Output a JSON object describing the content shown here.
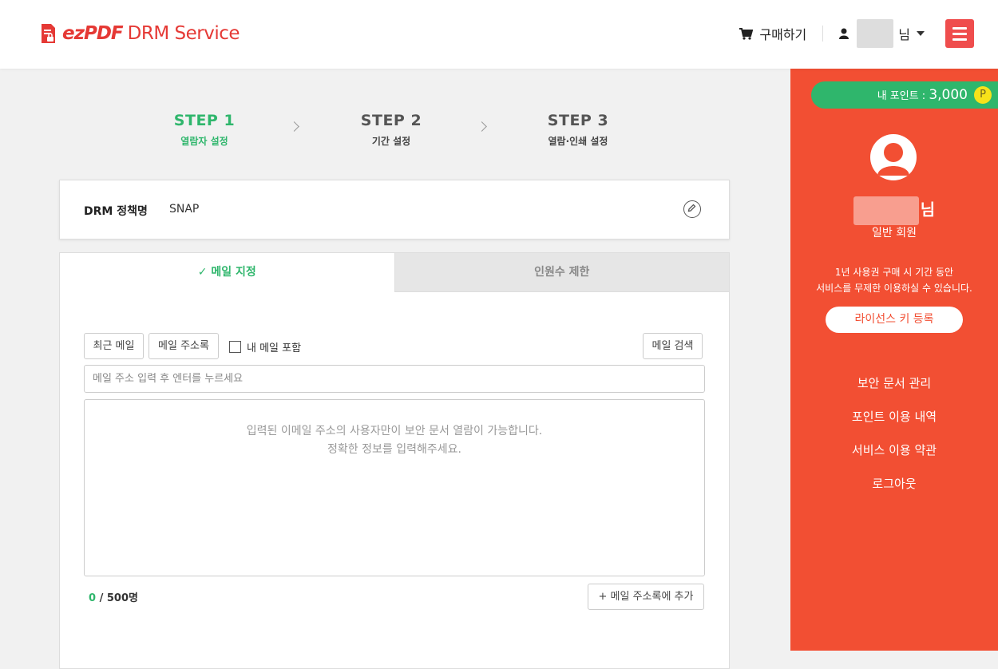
{
  "header": {
    "logo_brand": "ezPDF",
    "logo_product": "DRM Service",
    "buy_label": "구매하기",
    "user_suffix": "님"
  },
  "steps": [
    {
      "num": "STEP 1",
      "label": "열람자 설정",
      "active": true
    },
    {
      "num": "STEP 2",
      "label": "기간 설정",
      "active": false
    },
    {
      "num": "STEP 3",
      "label": "열람·인쇄 설정",
      "active": false
    }
  ],
  "policy": {
    "label": "DRM 정책명",
    "value": "SNAP"
  },
  "tabs": {
    "email": "메일 지정",
    "email_check": "✓",
    "count_limit": "인원수 제한"
  },
  "email_panel": {
    "recent_btn": "최근 메일",
    "addressbook_btn": "메일 주소록",
    "include_mine": "내 메일 포함",
    "search_btn": "메일 검색",
    "input_placeholder": "메일 주소 입력 후 엔터를 누르세요",
    "area_line1": "입력된 이메일 주소의 사용자만이 보안 문서 열람이 가능합니다.",
    "area_line2": "정확한 정보를 입력해주세요.",
    "count_current": "0",
    "count_max": " / 500명",
    "add_addressbook_btn": "+ 메일 주소록에 추가"
  },
  "sidebar": {
    "points_label": "내 포인트 : ",
    "points_value": "3,000",
    "points_badge": "P",
    "name_suffix": "님",
    "member_type": "일반 회원",
    "info_line1": "1년 사용권 구매 시 기간 동안",
    "info_line2": "서비스를 무제한 이용하실 수 있습니다.",
    "license_btn": "라이선스 키 등록",
    "menu": [
      "보안 문서 관리",
      "포인트 이용 내역",
      "서비스 이용 약관",
      "로그아웃"
    ]
  },
  "colors": {
    "accent_green": "#2fb66c",
    "sidebar_red": "#f24f33",
    "logo_red": "#e53935",
    "menu_button": "#ef4d4d"
  }
}
